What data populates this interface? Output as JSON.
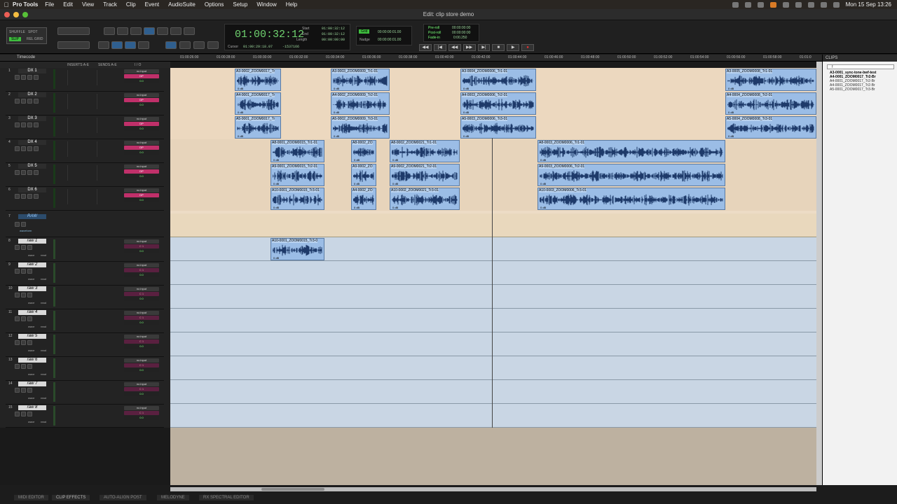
{
  "menubar": {
    "app": "Pro Tools",
    "items": [
      "File",
      "Edit",
      "View",
      "Track",
      "Clip",
      "Event",
      "AudioSuite",
      "Options",
      "Setup",
      "Window",
      "Help"
    ],
    "clock": "Mon 15 Sep 13:26"
  },
  "window": {
    "title": "Edit: clip store demo"
  },
  "toolbar": {
    "modes": [
      "SHUFFLE",
      "SPOT",
      "SLIP",
      "REL GRID"
    ],
    "counter": {
      "main": "01:00:32:12",
      "start_label": "Start",
      "end_label": "End",
      "length_label": "Length",
      "start": "01:00:32:12",
      "end": "01:00:32:12",
      "length": "00:00:00:00",
      "cursor_label": "Cursor",
      "cursor": "01:00:29:18.07",
      "sample": "-1537166"
    },
    "grid": {
      "badge": "Grid",
      "grid_val": "00:00:00:01.00",
      "nudge_label": "Nudge",
      "nudge_val": "00:00:00:01.00"
    },
    "preroll": {
      "pre_label": "Pre-roll",
      "post_label": "Post-roll",
      "fade_label": "Fade-in",
      "pre": "00:00:00:00",
      "post": "00:00:00:00",
      "fade": "0:00.250"
    },
    "transport": [
      "◀◀",
      "|◀",
      "◀◀",
      "▶▶",
      "▶|",
      "■",
      "▶",
      "●"
    ]
  },
  "ruler": {
    "label": "Timecode",
    "ticks": [
      "01:00:26:00",
      "01:00:28:00",
      "01:00:30:00",
      "01:00:32:00",
      "01:00:34:00",
      "01:00:36:00",
      "01:00:38:00",
      "01:00:40:00",
      "01:00:42:00",
      "01:00:44:00",
      "01:00:46:00",
      "01:00:48:00",
      "01:00:50:00",
      "01:00:52:00",
      "01:00:54:00",
      "01:00:56:00",
      "01:00:58:00",
      "01:01:0"
    ]
  },
  "columns": {
    "inserts": "INSERTS A-E",
    "sends": "SENDS A-E",
    "io": "I / O"
  },
  "tracks": [
    {
      "num": "1",
      "name": "DX 1",
      "input": "no input",
      "output": "DP",
      "vol": "0.0"
    },
    {
      "num": "2",
      "name": "DX 2",
      "input": "no input",
      "output": "DP",
      "vol": "0.0"
    },
    {
      "num": "3",
      "name": "DX 3",
      "input": "no input",
      "output": "DP",
      "vol": "0.0"
    },
    {
      "num": "4",
      "name": "DX 4",
      "input": "no input",
      "output": "DP",
      "vol": "0.0"
    },
    {
      "num": "5",
      "name": "DX 5",
      "input": "no input",
      "output": "DP",
      "vol": "0.0"
    },
    {
      "num": "6",
      "name": "DX 6",
      "input": "no input",
      "output": "DP",
      "vol": "0.0"
    }
  ],
  "folder": {
    "num": "7",
    "name": "RAW",
    "view": "waveform"
  },
  "raw_tracks": [
    {
      "num": "8",
      "name": "raw 1",
      "input": "no input",
      "output": "C 1",
      "vol": "0.0",
      "view": "wave",
      "mode": "read"
    },
    {
      "num": "9",
      "name": "raw 2",
      "input": "no input",
      "output": "C 1",
      "vol": "0.0",
      "view": "wave",
      "mode": "read"
    },
    {
      "num": "10",
      "name": "raw 3",
      "input": "no input",
      "output": "C 1",
      "vol": "0.0",
      "view": "wave",
      "mode": "read"
    },
    {
      "num": "11",
      "name": "raw 4",
      "input": "no input",
      "output": "C 1",
      "vol": "0.0",
      "view": "wave",
      "mode": "read"
    },
    {
      "num": "12",
      "name": "raw 5",
      "input": "no input",
      "output": "C 1",
      "vol": "0.0",
      "view": "wave",
      "mode": "read"
    },
    {
      "num": "13",
      "name": "raw 6",
      "input": "no input",
      "output": "C 1",
      "vol": "0.0",
      "view": "wave",
      "mode": "read"
    },
    {
      "num": "14",
      "name": "raw 7",
      "input": "no input",
      "output": "C 1",
      "vol": "0.0",
      "view": "wave",
      "mode": "read"
    },
    {
      "num": "15",
      "name": "raw 8",
      "input": "no input",
      "output": "C 1",
      "vol": "0.0",
      "view": "wave",
      "mode": "read"
    }
  ],
  "clips": {
    "c1a": "A3-0002_ZOOM0017_Tr",
    "c1b": "A3-0003_ZOOM0009_Tr1-01",
    "c1c": "A3-0004_ZOOM0006_Tr1-01",
    "c1d": "A3-0005_ZOOM0008_Tr1-01",
    "c2a": "A4-0001_ZOOM0017_Tr",
    "c2b": "A4-0002_ZOOM0009_Tr2-01",
    "c2c": "A4-0003_ZOOM0006_Tr2-01",
    "c2d": "A4-0004_ZOOM0008_Tr2-01",
    "c3a": "A5-0001_ZOOM0017_Tr",
    "c3b": "A5-0002_ZOOM0009_Tr3-01",
    "c3c": "A5-0003_ZOOM0006_Tr3-01",
    "c3d": "A5-0004_ZOOM0008_Tr3-01",
    "c4a": "A8-0001_ZOOM0015_Tr1-01",
    "c4b": "A8-0002_ZO",
    "c4c": "A8-0002_ZOOM0021_Tr1-01",
    "c4d": "A8-0003_ZOOM0006_Tr1-01",
    "c5a": "A9-0001_ZOOM0015_Tr2-01",
    "c5b": "A9-0002_ZO",
    "c5c": "A9-0002_ZOOM0021_Tr2-01",
    "c5d": "A9-0003_ZOOM0006_Tr2-01",
    "c6a": "A10-0001_ZOOM0015_Tr3-01",
    "c6b": "A4-0002_ZO",
    "c6c": "A10-0002_ZOOM0021_Tr3-01",
    "c6d": "A10-0003_ZOOM0006_Tr3-01",
    "craw": "A10-0001_ZOOM0015_Tr3-0",
    "db": "0 dB"
  },
  "clip_list": {
    "header": "CLIPS",
    "search": "f",
    "items": [
      "A3-0001_sync-tone-bwf-test",
      "A4-0001_ZOOM0017_Tr2-Br",
      "A4-0001_ZOOM0017_Tr2-Br",
      "A4-0001_ZOOM0017_Tr2-Br",
      "A5-0001_ZOOM0017_Tr3-Br"
    ]
  },
  "bottom_tabs": [
    "MIDI EDITOR",
    "CLIP EFFECTS",
    "AUTO-ALIGN POST",
    "MELODYNE",
    "RX SPECTRAL EDITOR"
  ],
  "colors": {
    "clip": "#9bbde6",
    "raw_lane": "#c9d6e4",
    "dx_lane": "#ecd8bf",
    "accent": "#3fbf3f"
  }
}
